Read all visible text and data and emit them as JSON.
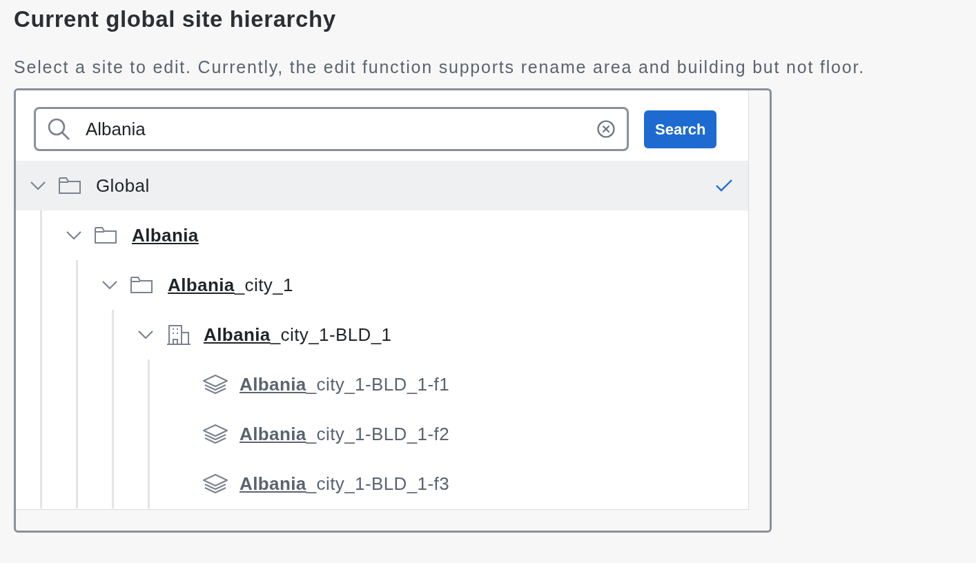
{
  "title": "Current global site hierarchy",
  "description": "Select a site to edit. Currently, the edit function supports rename area and building but not floor.",
  "search": {
    "value": "Albania",
    "button": "Search"
  },
  "tree": [
    {
      "kind": "area",
      "rest": "Global",
      "expanded": true,
      "selected": true,
      "children": [
        {
          "kind": "area",
          "match": "Albania",
          "expanded": true,
          "selected": false,
          "children": [
            {
              "kind": "area",
              "match": "Albania",
              "rest": "_city_1",
              "expanded": true,
              "selected": false,
              "children": [
                {
                  "kind": "building",
                  "match": "Albania",
                  "rest": "_city_1-BLD_1",
                  "expanded": true,
                  "selected": false,
                  "children": [
                    {
                      "kind": "floor",
                      "match": "Albania",
                      "rest": "_city_1-BLD_1-f1",
                      "selected": false
                    },
                    {
                      "kind": "floor",
                      "match": "Albania",
                      "rest": "_city_1-BLD_1-f2",
                      "selected": false
                    },
                    {
                      "kind": "floor",
                      "match": "Albania",
                      "rest": "_city_1-BLD_1-f3",
                      "selected": false
                    }
                  ]
                }
              ]
            }
          ]
        }
      ]
    }
  ]
}
